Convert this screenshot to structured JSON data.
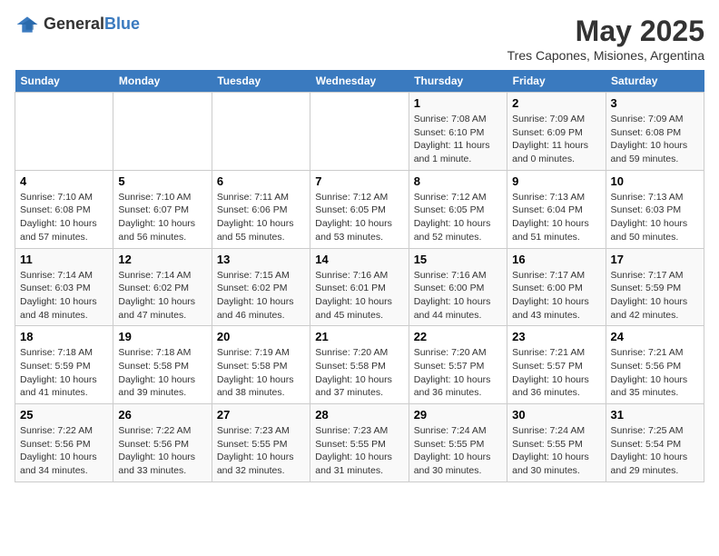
{
  "header": {
    "logo_general": "General",
    "logo_blue": "Blue",
    "title": "May 2025",
    "subtitle": "Tres Capones, Misiones, Argentina"
  },
  "days_of_week": [
    "Sunday",
    "Monday",
    "Tuesday",
    "Wednesday",
    "Thursday",
    "Friday",
    "Saturday"
  ],
  "weeks": [
    [
      {
        "day": "",
        "info": ""
      },
      {
        "day": "",
        "info": ""
      },
      {
        "day": "",
        "info": ""
      },
      {
        "day": "",
        "info": ""
      },
      {
        "day": "1",
        "info": "Sunrise: 7:08 AM\nSunset: 6:10 PM\nDaylight: 11 hours\nand 1 minute."
      },
      {
        "day": "2",
        "info": "Sunrise: 7:09 AM\nSunset: 6:09 PM\nDaylight: 11 hours\nand 0 minutes."
      },
      {
        "day": "3",
        "info": "Sunrise: 7:09 AM\nSunset: 6:08 PM\nDaylight: 10 hours\nand 59 minutes."
      }
    ],
    [
      {
        "day": "4",
        "info": "Sunrise: 7:10 AM\nSunset: 6:08 PM\nDaylight: 10 hours\nand 57 minutes."
      },
      {
        "day": "5",
        "info": "Sunrise: 7:10 AM\nSunset: 6:07 PM\nDaylight: 10 hours\nand 56 minutes."
      },
      {
        "day": "6",
        "info": "Sunrise: 7:11 AM\nSunset: 6:06 PM\nDaylight: 10 hours\nand 55 minutes."
      },
      {
        "day": "7",
        "info": "Sunrise: 7:12 AM\nSunset: 6:05 PM\nDaylight: 10 hours\nand 53 minutes."
      },
      {
        "day": "8",
        "info": "Sunrise: 7:12 AM\nSunset: 6:05 PM\nDaylight: 10 hours\nand 52 minutes."
      },
      {
        "day": "9",
        "info": "Sunrise: 7:13 AM\nSunset: 6:04 PM\nDaylight: 10 hours\nand 51 minutes."
      },
      {
        "day": "10",
        "info": "Sunrise: 7:13 AM\nSunset: 6:03 PM\nDaylight: 10 hours\nand 50 minutes."
      }
    ],
    [
      {
        "day": "11",
        "info": "Sunrise: 7:14 AM\nSunset: 6:03 PM\nDaylight: 10 hours\nand 48 minutes."
      },
      {
        "day": "12",
        "info": "Sunrise: 7:14 AM\nSunset: 6:02 PM\nDaylight: 10 hours\nand 47 minutes."
      },
      {
        "day": "13",
        "info": "Sunrise: 7:15 AM\nSunset: 6:02 PM\nDaylight: 10 hours\nand 46 minutes."
      },
      {
        "day": "14",
        "info": "Sunrise: 7:16 AM\nSunset: 6:01 PM\nDaylight: 10 hours\nand 45 minutes."
      },
      {
        "day": "15",
        "info": "Sunrise: 7:16 AM\nSunset: 6:00 PM\nDaylight: 10 hours\nand 44 minutes."
      },
      {
        "day": "16",
        "info": "Sunrise: 7:17 AM\nSunset: 6:00 PM\nDaylight: 10 hours\nand 43 minutes."
      },
      {
        "day": "17",
        "info": "Sunrise: 7:17 AM\nSunset: 5:59 PM\nDaylight: 10 hours\nand 42 minutes."
      }
    ],
    [
      {
        "day": "18",
        "info": "Sunrise: 7:18 AM\nSunset: 5:59 PM\nDaylight: 10 hours\nand 41 minutes."
      },
      {
        "day": "19",
        "info": "Sunrise: 7:18 AM\nSunset: 5:58 PM\nDaylight: 10 hours\nand 39 minutes."
      },
      {
        "day": "20",
        "info": "Sunrise: 7:19 AM\nSunset: 5:58 PM\nDaylight: 10 hours\nand 38 minutes."
      },
      {
        "day": "21",
        "info": "Sunrise: 7:20 AM\nSunset: 5:58 PM\nDaylight: 10 hours\nand 37 minutes."
      },
      {
        "day": "22",
        "info": "Sunrise: 7:20 AM\nSunset: 5:57 PM\nDaylight: 10 hours\nand 36 minutes."
      },
      {
        "day": "23",
        "info": "Sunrise: 7:21 AM\nSunset: 5:57 PM\nDaylight: 10 hours\nand 36 minutes."
      },
      {
        "day": "24",
        "info": "Sunrise: 7:21 AM\nSunset: 5:56 PM\nDaylight: 10 hours\nand 35 minutes."
      }
    ],
    [
      {
        "day": "25",
        "info": "Sunrise: 7:22 AM\nSunset: 5:56 PM\nDaylight: 10 hours\nand 34 minutes."
      },
      {
        "day": "26",
        "info": "Sunrise: 7:22 AM\nSunset: 5:56 PM\nDaylight: 10 hours\nand 33 minutes."
      },
      {
        "day": "27",
        "info": "Sunrise: 7:23 AM\nSunset: 5:55 PM\nDaylight: 10 hours\nand 32 minutes."
      },
      {
        "day": "28",
        "info": "Sunrise: 7:23 AM\nSunset: 5:55 PM\nDaylight: 10 hours\nand 31 minutes."
      },
      {
        "day": "29",
        "info": "Sunrise: 7:24 AM\nSunset: 5:55 PM\nDaylight: 10 hours\nand 30 minutes."
      },
      {
        "day": "30",
        "info": "Sunrise: 7:24 AM\nSunset: 5:55 PM\nDaylight: 10 hours\nand 30 minutes."
      },
      {
        "day": "31",
        "info": "Sunrise: 7:25 AM\nSunset: 5:54 PM\nDaylight: 10 hours\nand 29 minutes."
      }
    ]
  ]
}
